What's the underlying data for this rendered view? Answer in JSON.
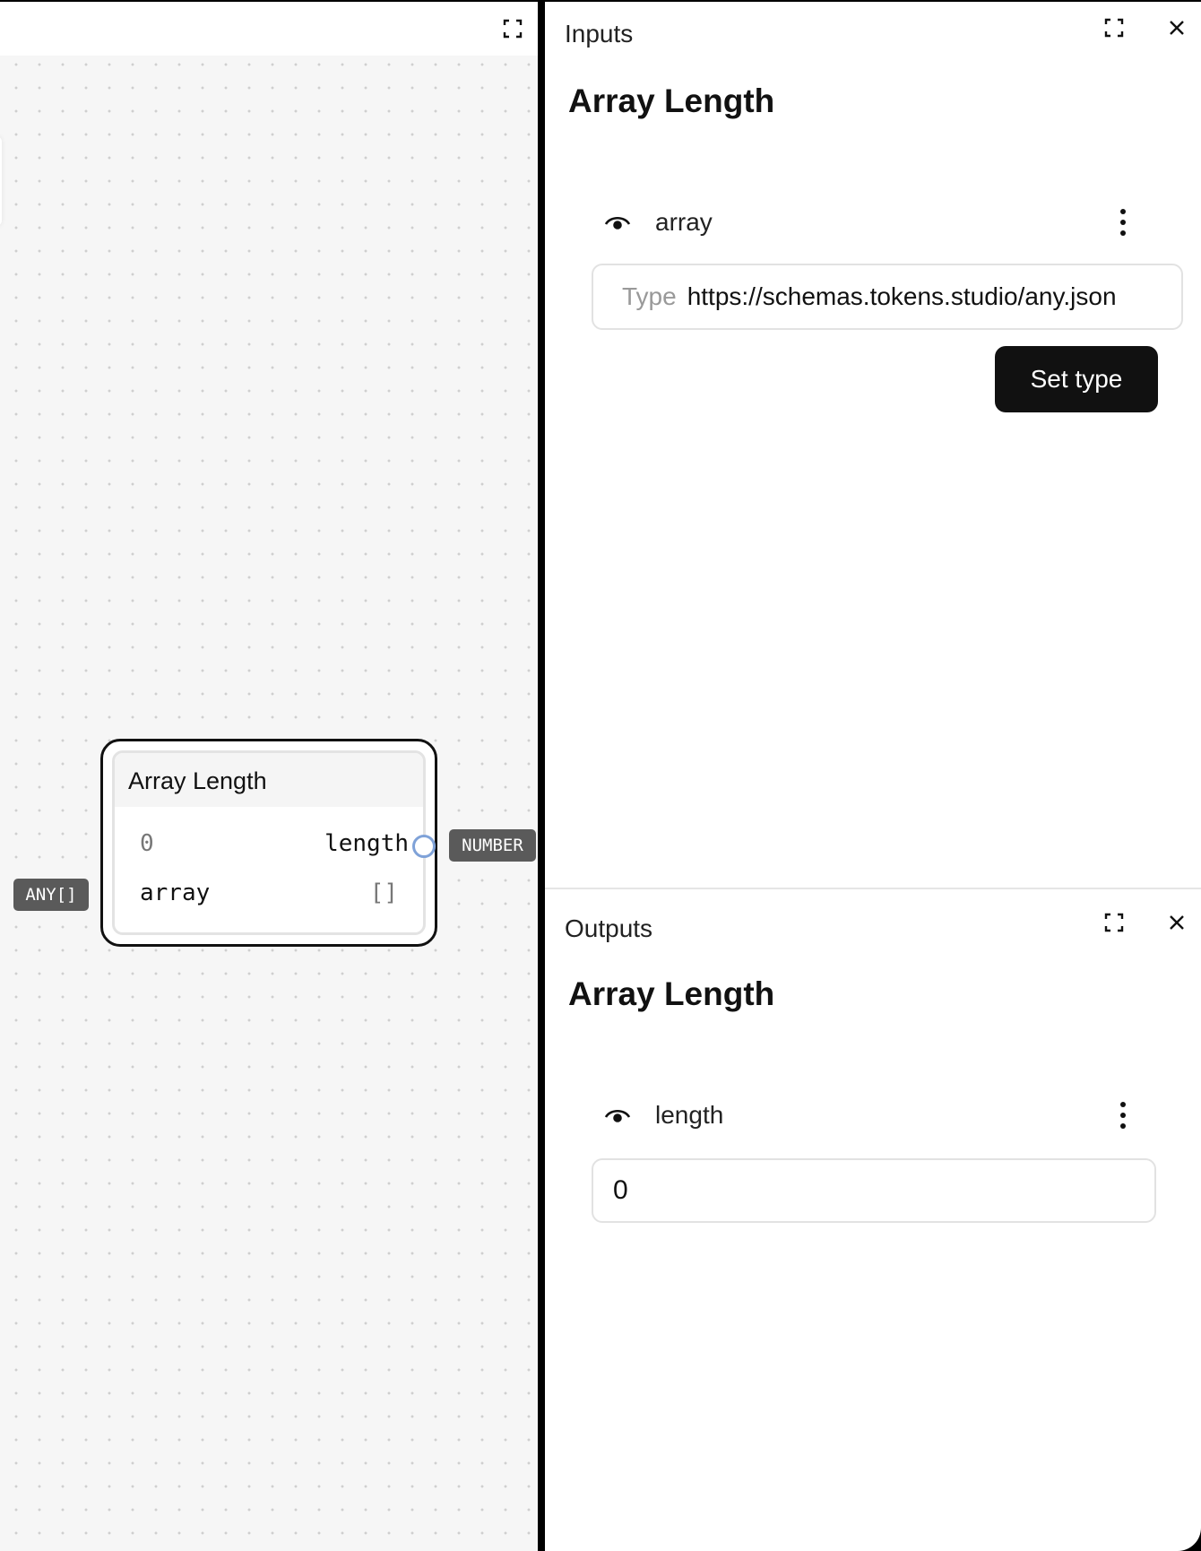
{
  "canvas": {
    "fullscreen_icon": "fullscreen-icon",
    "node": {
      "title": "Array Length",
      "output_row": {
        "value": "0",
        "name": "length"
      },
      "input_row": {
        "name": "array",
        "value": "[]"
      },
      "input_type_badge": "ANY[]",
      "output_type_badge": "NUMBER"
    }
  },
  "inputs_panel": {
    "label": "Inputs",
    "title": "Array Length",
    "field": {
      "visibility_icon": "eye-icon",
      "name": "array",
      "menu_icon": "more-vertical-icon",
      "type_label": "Type",
      "type_value": "https://schemas.tokens.studio/any.json",
      "set_type_label": "Set type"
    }
  },
  "outputs_panel": {
    "label": "Outputs",
    "title": "Array Length",
    "field": {
      "visibility_icon": "eye-icon",
      "name": "length",
      "menu_icon": "more-vertical-icon",
      "value": "0"
    }
  },
  "colors": {
    "input_port": "#7b63c9",
    "output_port": "#7fa2d8",
    "badge_bg": "#5a5a5a",
    "primary_button": "#111111"
  }
}
